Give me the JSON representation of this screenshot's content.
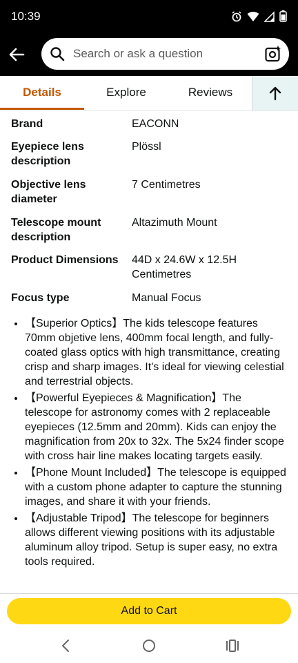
{
  "status_bar": {
    "time": "10:39"
  },
  "search": {
    "placeholder": "Search or ask a question"
  },
  "tabs": [
    {
      "label": "Details"
    },
    {
      "label": "Explore"
    },
    {
      "label": "Reviews"
    }
  ],
  "specs": [
    {
      "key": "Brand",
      "value": "EACONN"
    },
    {
      "key": "Eyepiece lens description",
      "value": "Plössl"
    },
    {
      "key": "Objective lens diameter",
      "value": "7 Centimetres"
    },
    {
      "key": "Telescope mount description",
      "value": "Altazimuth Mount"
    },
    {
      "key": "Product Dimensions",
      "value": "44D x 24.6W x 12.5H Centimetres"
    },
    {
      "key": "Focus type",
      "value": "Manual Focus"
    }
  ],
  "bullets": [
    "【Superior Optics】The kids telescope features 70mm objetive lens, 400mm focal length, and fully-coated glass optics with high transmittance, creating crisp and sharp images. It's ideal for viewing celestial and terrestrial objects.",
    "【Powerful Eyepieces & Magnification】The telescope for astronomy comes with 2 replaceable eyepieces (12.5mm and 20mm). Kids can enjoy the magnification from 20x to 32x. The 5x24 finder scope with cross hair line makes locating targets easily.",
    "【Phone Mount Included】The telescope is equipped with a custom phone adapter to capture the stunning images, and share it with your friends.",
    "【Adjustable Tripod】The telescope for beginners allows different viewing positions with its adjustable aluminum alloy tripod. Setup is super easy, no extra tools required."
  ],
  "cart": {
    "label": "Add to Cart"
  },
  "colors": {
    "accent": "#c45500",
    "cart_button": "#ffd814",
    "top_bar": "#000000"
  }
}
